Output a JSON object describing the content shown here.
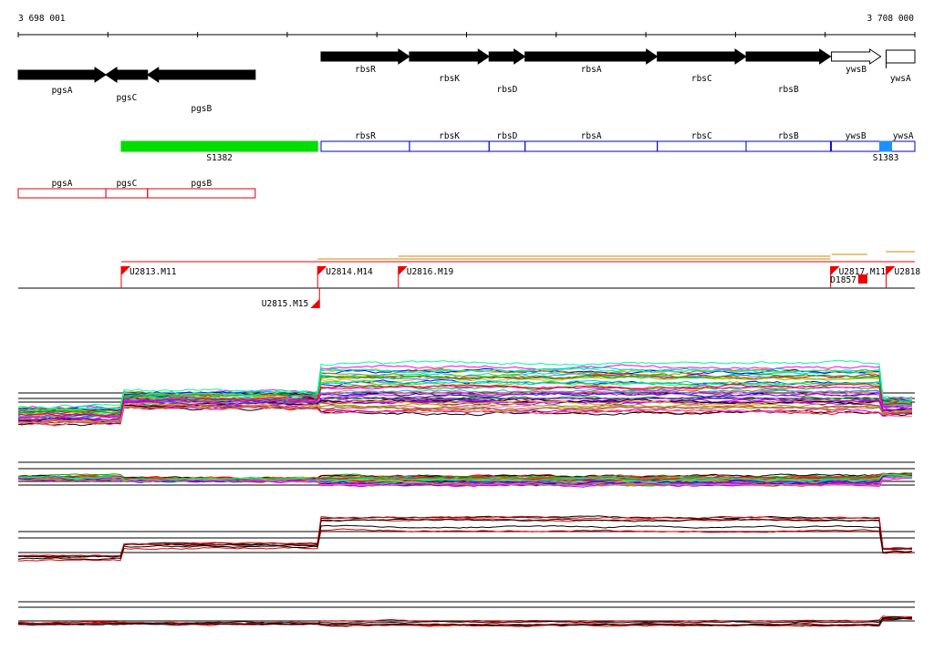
{
  "axis": {
    "start_label": "3 698 001",
    "end_label": "3 708 000"
  },
  "genes": [
    {
      "name": "pgsA",
      "strand": "+",
      "style": "filled",
      "start": 3698001,
      "end": 3698978
    },
    {
      "name": "pgsC",
      "strand": "-",
      "style": "filled",
      "start": 3698978,
      "end": 3699443
    },
    {
      "name": "pgsB",
      "strand": "-",
      "style": "filled",
      "start": 3699443,
      "end": 3700644
    },
    {
      "name": "rbsR",
      "strand": "+",
      "style": "filled",
      "start": 3701378,
      "end": 3702364
    },
    {
      "name": "rbsK",
      "strand": "+",
      "style": "filled",
      "start": 3702364,
      "end": 3703252
    },
    {
      "name": "rbsD",
      "strand": "+",
      "style": "filled",
      "start": 3703252,
      "end": 3703653
    },
    {
      "name": "rbsA",
      "strand": "+",
      "style": "filled",
      "start": 3703653,
      "end": 3705128
    },
    {
      "name": "rbsC",
      "strand": "+",
      "style": "filled",
      "start": 3705128,
      "end": 3706118
    },
    {
      "name": "rbsB",
      "strand": "+",
      "style": "filled",
      "start": 3706118,
      "end": 3707060
    },
    {
      "name": "ywsB",
      "strand": "+",
      "style": "open",
      "start": 3707070,
      "end": 3707620
    },
    {
      "name": "ywsA",
      "strand": "+",
      "style": "open",
      "start": 3707680,
      "end": 3708000
    }
  ],
  "segments_plus": {
    "boxes": [
      {
        "name": "rbsR",
        "start": 3701378,
        "end": 3702364
      },
      {
        "name": "rbsK",
        "start": 3702364,
        "end": 3703252
      },
      {
        "name": "rbsD",
        "start": 3703252,
        "end": 3703653
      },
      {
        "name": "rbsA",
        "start": 3703653,
        "end": 3705128
      },
      {
        "name": "rbsC",
        "start": 3705128,
        "end": 3706118
      },
      {
        "name": "rbsB",
        "start": 3706118,
        "end": 3707060
      },
      {
        "name": "ywsB",
        "start": 3707070,
        "end": 3707610
      },
      {
        "name": "ywsA",
        "start": 3707740,
        "end": 3708000
      }
    ],
    "features": [
      {
        "name": "S1382",
        "start": 3699150,
        "end": 3701340,
        "color": "#00dd00"
      },
      {
        "name": "S1383",
        "start": 3707610,
        "end": 3707740,
        "color": "#1e90ff"
      }
    ]
  },
  "segments_minus": [
    {
      "name": "pgsA",
      "start": 3698001,
      "end": 3698978
    },
    {
      "name": "pgsC",
      "start": 3698978,
      "end": 3699443
    },
    {
      "name": "pgsB",
      "start": 3699443,
      "end": 3700644
    }
  ],
  "tus": [
    {
      "name": "U2813.M11",
      "pos": 3699150,
      "strand": "+"
    },
    {
      "name": "U2814.M14",
      "pos": 3701340,
      "strand": "+"
    },
    {
      "name": "U2815.M15",
      "pos": 3701340,
      "strand": "-"
    },
    {
      "name": "U2816.M19",
      "pos": 3702240,
      "strand": "+"
    },
    {
      "name": "U2817.M11",
      "pos": 3707060,
      "strand": "+"
    },
    {
      "name": "D1857",
      "pos": 3707470,
      "strand": "-"
    },
    {
      "name": "U2818",
      "pos": 3707680,
      "strand": "+"
    }
  ],
  "tu_extents": [
    {
      "start": 3699150,
      "end": 3708000
    },
    {
      "start": 3701340,
      "end": 3707060
    },
    {
      "start": 3702240,
      "end": 3707060
    },
    {
      "start": 3707070,
      "end": 3707470
    },
    {
      "start": 3707680,
      "end": 3708000
    }
  ],
  "colors": {
    "gene_fill": "#000000",
    "segment_plus": "#0000cc",
    "segment_minus": "#dd0000",
    "tu": "#ee0000",
    "tu_extent": "#cc8800"
  }
}
